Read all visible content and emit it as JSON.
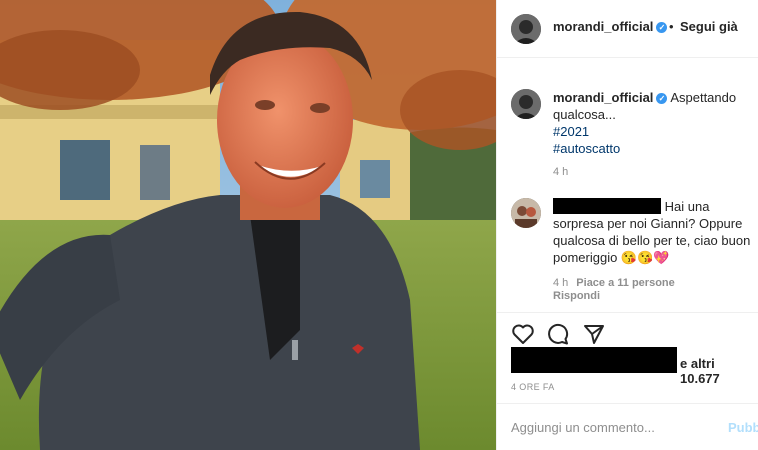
{
  "post": {
    "username": "morandi_official",
    "follow_status": "Segui già",
    "separator": "•",
    "photo_icon": "person-selfie-photo"
  },
  "caption": {
    "username": "morandi_official",
    "text": "Aspettando qualcosa...",
    "hashtags": [
      "#2021",
      "#autoscatto"
    ],
    "time": "4 h"
  },
  "comment": {
    "text": "Hai una sorpresa per noi Gianni? Oppure qualcosa di bello per te, ciao buon pomeriggio 😘😘💖",
    "time": "4 h",
    "likes": "Piace a 11 persone",
    "reply": "Rispondi"
  },
  "actions": {
    "icons": [
      "heart-icon",
      "comment-icon",
      "share-icon"
    ],
    "likes_suffix": "e altri 10.677",
    "date": "4 ORE FA"
  },
  "add_comment": {
    "placeholder": "Aggiungi un commento...",
    "publish": "Pubblica"
  },
  "colors": {
    "link": "#00376b",
    "verified": "#3897f0",
    "muted": "#8e8e8e",
    "publish_disabled": "#b2dffc"
  }
}
